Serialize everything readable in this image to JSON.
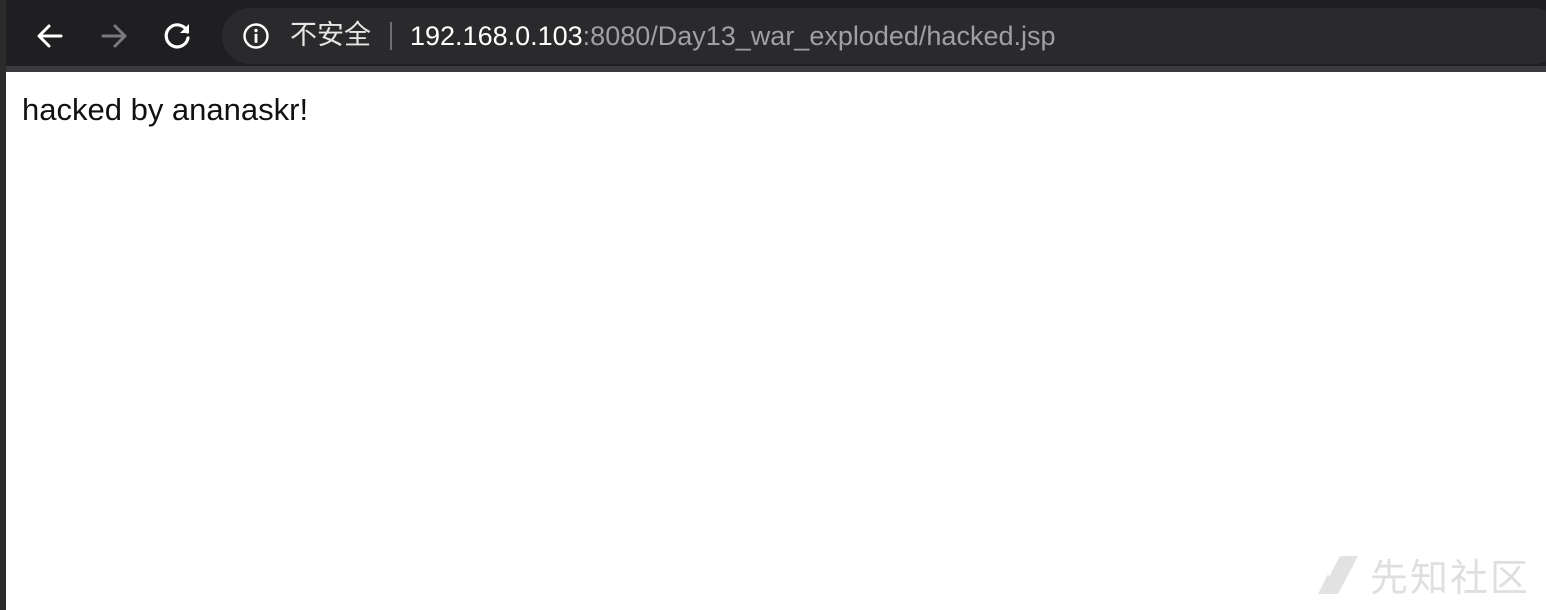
{
  "browser": {
    "nav": {
      "back_icon": "arrow-left-icon",
      "forward_icon": "arrow-right-icon",
      "reload_icon": "reload-icon"
    },
    "omnibox": {
      "security_icon": "info-circle-icon",
      "security_label": "不安全",
      "url_host": "192.168.0.103",
      "url_rest": ":8080/Day13_war_exploded/hacked.jsp"
    }
  },
  "page": {
    "body_text": "hacked by ananaskr!"
  },
  "watermark": {
    "text": "先知社区"
  },
  "colors": {
    "toolbar_bg": "#1f1f21",
    "omnibox_bg": "#2a2a2c",
    "url_host": "#ffffff",
    "url_rest": "#a0a0a3",
    "page_bg": "#ffffff"
  }
}
